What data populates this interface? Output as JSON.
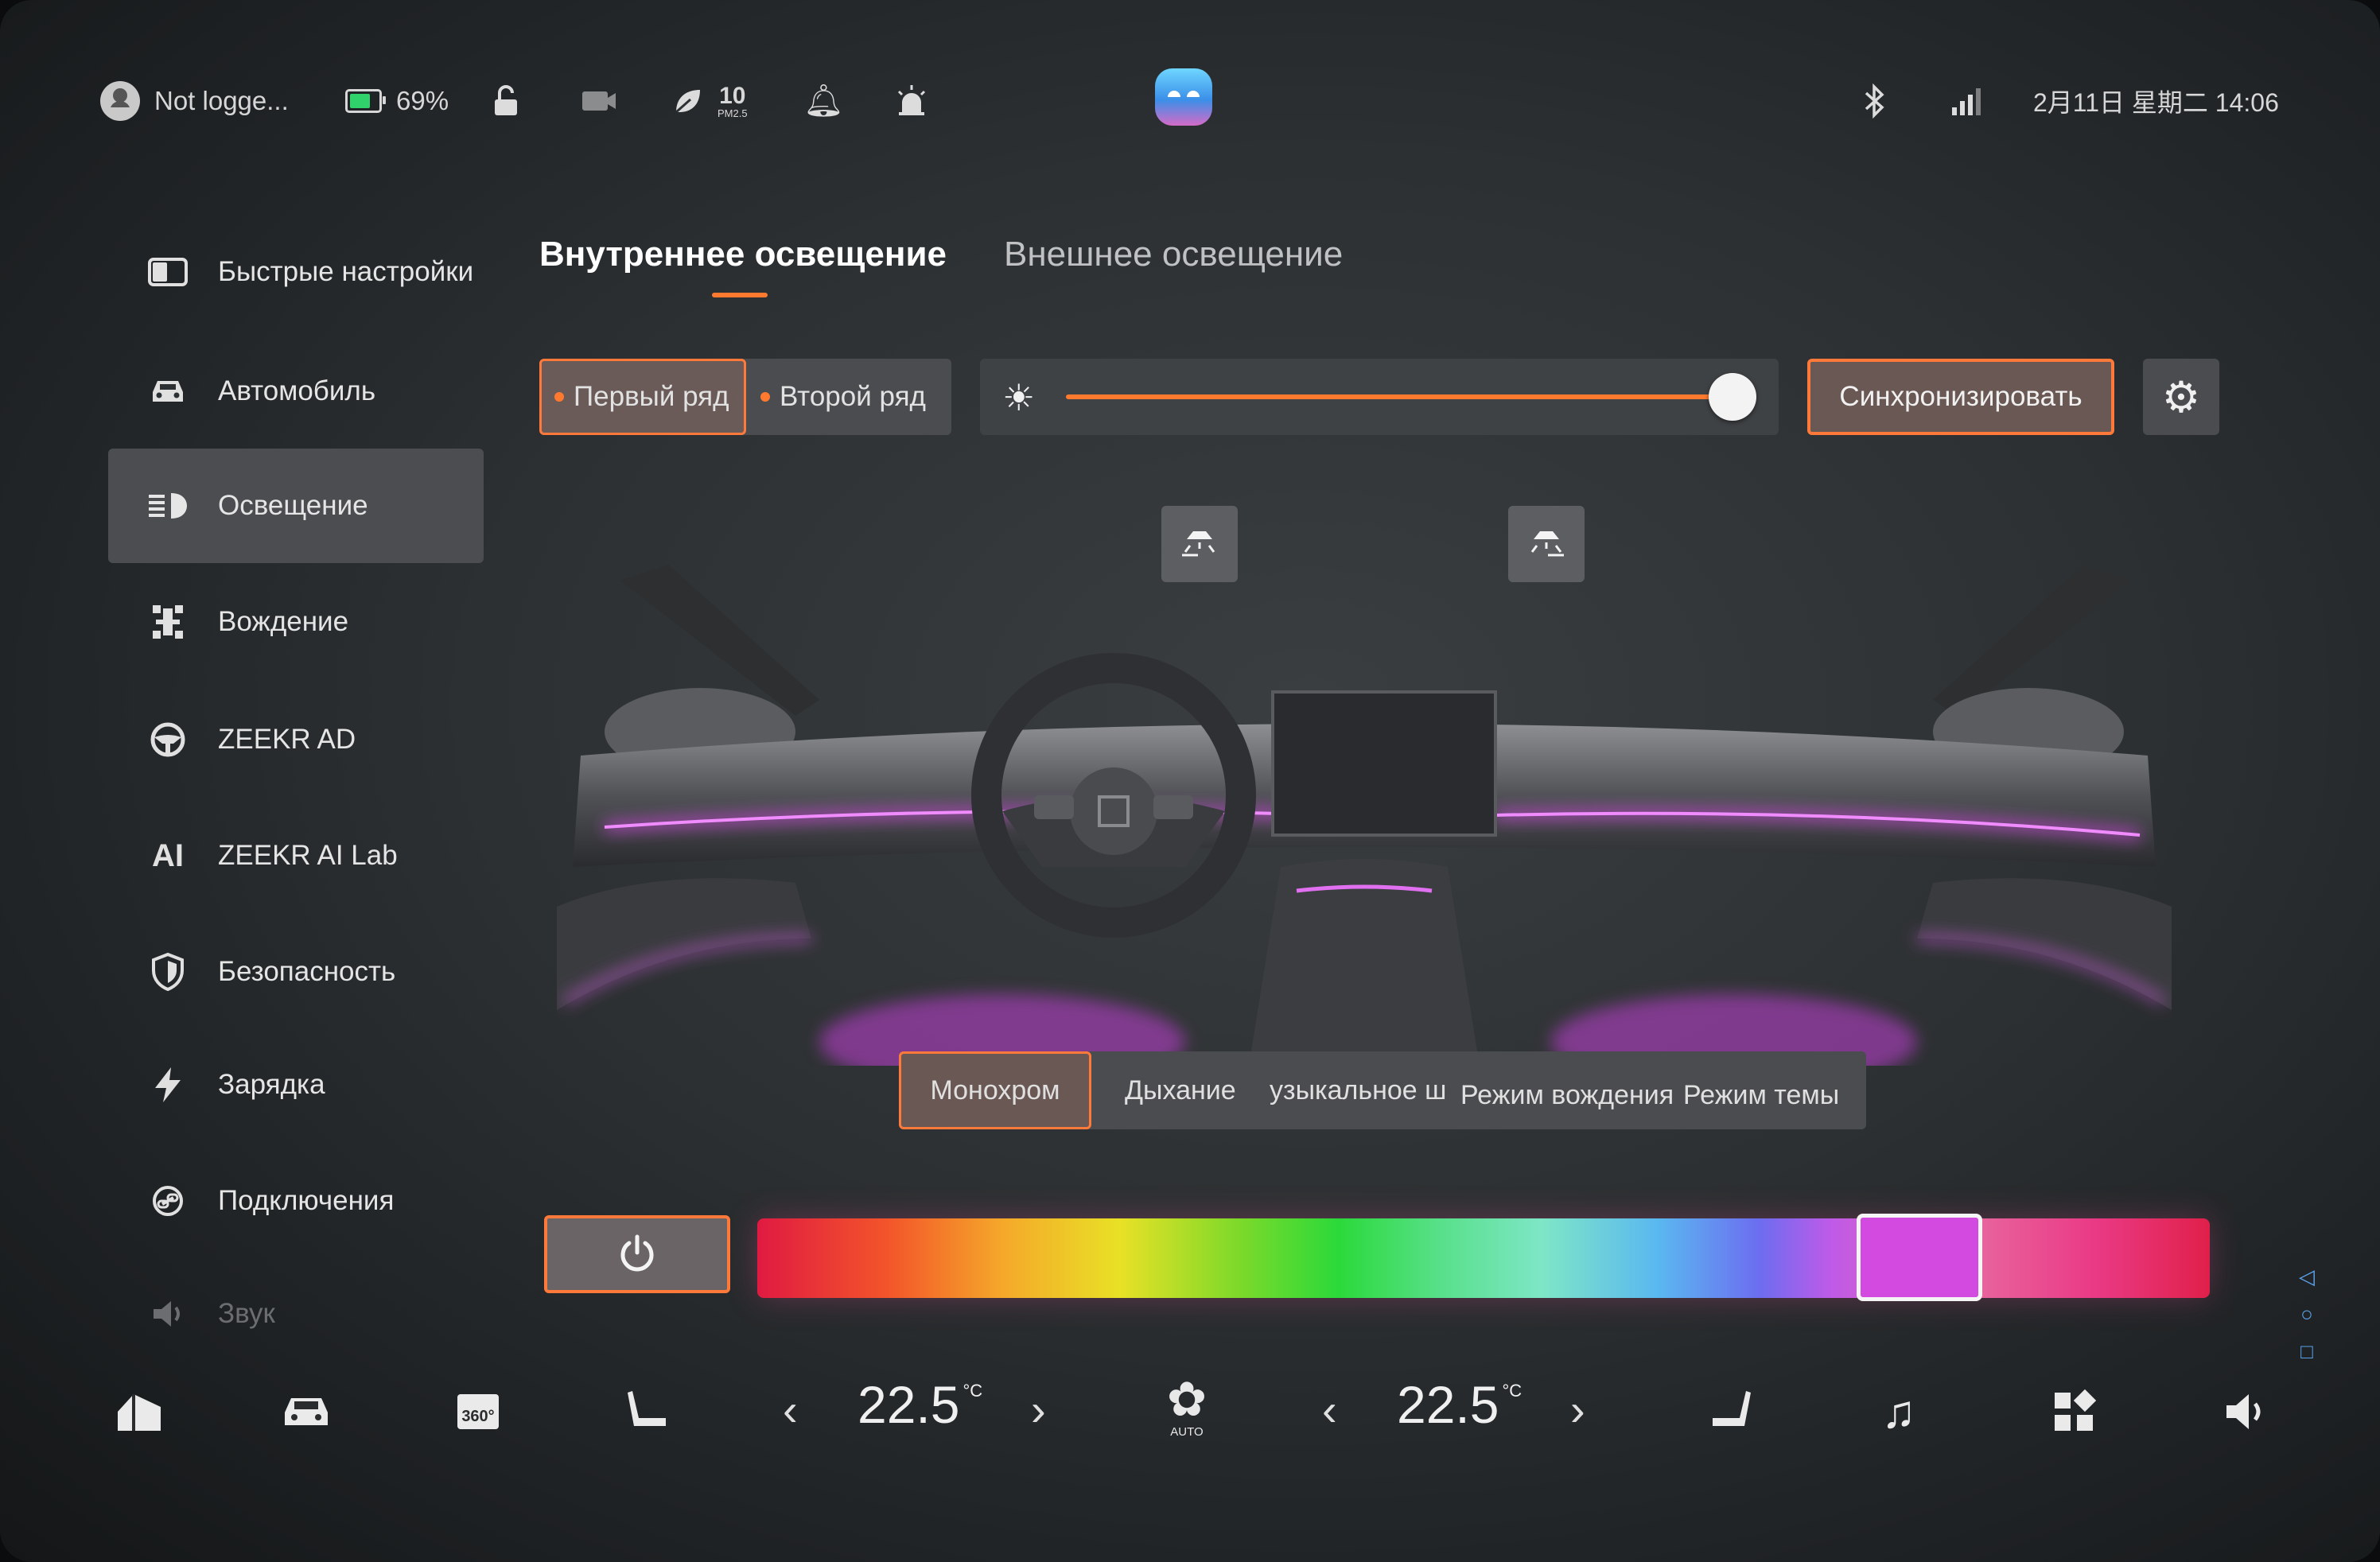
{
  "status_bar": {
    "user_label": "Not logge...",
    "battery_percent": "69%",
    "battery_color": "#2fd26b",
    "pm_value": "10",
    "pm_unit": "PM2.5",
    "datetime": "2月11日 星期二 14:06",
    "icons": [
      "user-icon",
      "battery-icon",
      "lock-icon",
      "dashcam-icon",
      "leaf-icon",
      "bell-icon",
      "alarm-icon",
      "assistant-icon",
      "bluetooth-icon",
      "signal-icon"
    ]
  },
  "sidebar": {
    "items": [
      {
        "label": "Быстрые настройки",
        "icon": "quick-settings-icon"
      },
      {
        "label": "Автомобиль",
        "icon": "car-icon"
      },
      {
        "label": "Освещение",
        "icon": "headlight-icon"
      },
      {
        "label": "Вождение",
        "icon": "driving-icon"
      },
      {
        "label": "ZEEKR AD",
        "icon": "steering-wheel-icon"
      },
      {
        "label": "ZEEKR AI Lab",
        "icon": "ai-icon",
        "icon_text": "AI"
      },
      {
        "label": "Безопасность",
        "icon": "shield-icon"
      },
      {
        "label": "Зарядка",
        "icon": "lightning-icon"
      },
      {
        "label": "Подключения",
        "icon": "link-icon"
      },
      {
        "label": "Звук",
        "icon": "speaker-icon"
      }
    ],
    "active_index": 2
  },
  "tabs": {
    "items": [
      {
        "label": "Внутреннее освещение"
      },
      {
        "label": "Внешнее освещение"
      }
    ],
    "active_index": 0,
    "accent_color": "#ff7a2e"
  },
  "row_selector": {
    "options": [
      {
        "label": "Первый ряд"
      },
      {
        "label": "Второй ряд"
      }
    ],
    "active_index": 0
  },
  "brightness": {
    "level_fraction": 0.97
  },
  "sync_button": {
    "label": "Синхронизировать"
  },
  "zone_buttons": [
    "front-reading-lamp-icon",
    "rear-reading-lamp-icon"
  ],
  "ambient_color": "#d24ae0",
  "lighting_modes": {
    "options": [
      {
        "label": "Монохром"
      },
      {
        "label": "Дыхание"
      },
      {
        "label": "узыкальное ш"
      },
      {
        "label": "Режим вождения"
      },
      {
        "label": "Режим темы"
      }
    ],
    "active_index": 0
  },
  "color_picker": {
    "selected_position_fraction": 0.8,
    "selected_color": "#d24ae0"
  },
  "dock": {
    "left_temp": "22.5",
    "right_temp": "22.5",
    "temp_unit": "°C",
    "fan_label": "AUTO",
    "icons": [
      "home-icon",
      "car-icon",
      "camera-360-icon",
      "driver-seat-icon",
      "fan-icon",
      "passenger-seat-icon",
      "music-icon",
      "apps-icon",
      "volume-icon"
    ],
    "cam_label": "360°"
  }
}
